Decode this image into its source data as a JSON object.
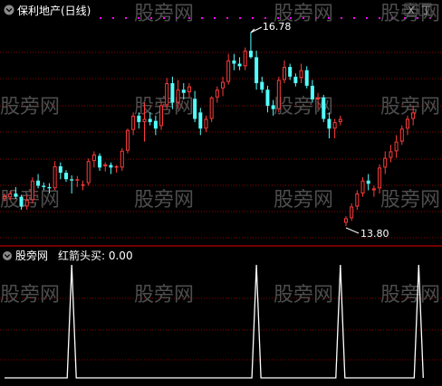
{
  "header": {
    "stock_title": "保利地产(日线)",
    "indicator_prefix": "股旁网",
    "indicator_label": "红箭头买: 0.00",
    "x_box": "X",
    "corner_box": "丁"
  },
  "watermark_text": "股旁网",
  "colors": {
    "background": "#000000",
    "up": "#ff3c3c",
    "down": "#54ffff",
    "grid": "#8b0000",
    "divider": "#9a0000",
    "line": "#ffffff",
    "dots": "#ff00ff",
    "text": "#ffffff",
    "watermark": "#555555"
  },
  "chart_data": [
    {
      "type": "candlestick",
      "title": "保利地产(日线)",
      "annotations": [
        {
          "label": "16.78",
          "value": 16.78,
          "kind": "max"
        },
        {
          "label": "13.80",
          "value": 13.8,
          "kind": "min"
        }
      ],
      "candles": [
        [
          14.22,
          14.3,
          14.18,
          14.26
        ],
        [
          14.24,
          14.34,
          14.2,
          14.3
        ],
        [
          14.3,
          14.4,
          14.22,
          14.25
        ],
        [
          14.25,
          14.28,
          14.05,
          14.1
        ],
        [
          14.1,
          14.28,
          14.05,
          14.2
        ],
        [
          14.2,
          14.55,
          14.15,
          14.5
        ],
        [
          14.5,
          14.6,
          14.38,
          14.42
        ],
        [
          14.42,
          14.47,
          14.35,
          14.4
        ],
        [
          14.4,
          14.46,
          14.3,
          14.38
        ],
        [
          14.38,
          14.8,
          14.35,
          14.72
        ],
        [
          14.72,
          14.78,
          14.52,
          14.62
        ],
        [
          14.62,
          14.66,
          14.48,
          14.52
        ],
        [
          14.52,
          14.58,
          14.3,
          14.5
        ],
        [
          14.5,
          14.57,
          14.4,
          14.52
        ],
        [
          14.42,
          14.5,
          14.35,
          14.44
        ],
        [
          14.46,
          14.84,
          14.42,
          14.8
        ],
        [
          14.8,
          14.95,
          14.7,
          14.9
        ],
        [
          14.88,
          14.92,
          14.65,
          14.7
        ],
        [
          14.72,
          14.78,
          14.64,
          14.75
        ],
        [
          14.74,
          14.78,
          14.6,
          14.7
        ],
        [
          14.7,
          14.74,
          14.62,
          14.72
        ],
        [
          14.7,
          15.0,
          14.65,
          14.96
        ],
        [
          14.96,
          15.3,
          14.92,
          15.28
        ],
        [
          15.28,
          15.55,
          15.2,
          15.5
        ],
        [
          15.5,
          15.55,
          15.3,
          15.4
        ],
        [
          15.4,
          15.7,
          15.1,
          15.45
        ],
        [
          15.45,
          15.55,
          15.35,
          15.4
        ],
        [
          15.42,
          15.5,
          15.2,
          15.3
        ],
        [
          15.34,
          15.7,
          15.28,
          15.66
        ],
        [
          15.66,
          16.08,
          15.6,
          16.0
        ],
        [
          16.0,
          16.1,
          15.6,
          15.7
        ],
        [
          15.7,
          16.05,
          15.6,
          15.9
        ],
        [
          15.9,
          16.0,
          15.75,
          15.85
        ],
        [
          15.86,
          16.0,
          15.78,
          15.95
        ],
        [
          15.76,
          15.88,
          15.4,
          15.45
        ],
        [
          15.55,
          15.62,
          15.2,
          15.3
        ],
        [
          15.3,
          15.5,
          15.25,
          15.45
        ],
        [
          15.45,
          15.8,
          15.4,
          15.78
        ],
        [
          15.78,
          15.95,
          15.7,
          15.9
        ],
        [
          15.92,
          16.1,
          15.8,
          16.02
        ],
        [
          16.02,
          16.45,
          15.98,
          16.35
        ],
        [
          16.35,
          16.45,
          16.2,
          16.3
        ],
        [
          16.3,
          16.4,
          16.2,
          16.26
        ],
        [
          16.26,
          16.55,
          16.2,
          16.5
        ],
        [
          16.5,
          16.78,
          16.38,
          16.4
        ],
        [
          16.4,
          16.5,
          15.9,
          16.0
        ],
        [
          16.02,
          16.1,
          15.85,
          15.9
        ],
        [
          15.9,
          15.96,
          15.55,
          15.65
        ],
        [
          15.66,
          15.74,
          15.5,
          15.6
        ],
        [
          15.6,
          16.1,
          15.55,
          16.05
        ],
        [
          16.05,
          16.35,
          16.0,
          16.25
        ],
        [
          16.25,
          16.3,
          16.05,
          16.1
        ],
        [
          16.1,
          16.15,
          15.95,
          16.0
        ],
        [
          16.08,
          16.3,
          16.0,
          16.2
        ],
        [
          16.2,
          16.26,
          15.92,
          15.96
        ],
        [
          15.96,
          16.05,
          15.7,
          15.75
        ],
        [
          15.75,
          15.85,
          15.6,
          15.78
        ],
        [
          15.78,
          15.82,
          15.4,
          15.45
        ],
        [
          15.45,
          15.55,
          15.15,
          15.3
        ],
        [
          15.3,
          15.45,
          15.15,
          15.4
        ],
        [
          15.4,
          15.5,
          15.35,
          15.45
        ],
        [
          13.85,
          13.95,
          13.8,
          13.92
        ],
        [
          13.92,
          14.15,
          13.88,
          14.1
        ],
        [
          14.1,
          14.35,
          14.05,
          14.3
        ],
        [
          14.3,
          14.55,
          14.25,
          14.5
        ],
        [
          14.5,
          14.6,
          14.35,
          14.45
        ],
        [
          14.35,
          14.42,
          14.25,
          14.38
        ],
        [
          14.38,
          14.75,
          14.3,
          14.7
        ],
        [
          14.7,
          14.95,
          14.6,
          14.85
        ],
        [
          14.85,
          15.05,
          14.78,
          14.95
        ],
        [
          14.95,
          15.2,
          14.85,
          15.1
        ],
        [
          15.1,
          15.35,
          15.05,
          15.3
        ],
        [
          15.3,
          15.5,
          15.2,
          15.45
        ],
        [
          15.45,
          15.65,
          15.35,
          15.55
        ]
      ]
    },
    {
      "type": "line",
      "title": "红箭头买",
      "current_value": 0.0,
      "x": [
        0,
        12,
        22,
        30,
        45,
        55,
        60,
        63,
        74
      ],
      "y": [
        0,
        1,
        0,
        0,
        1,
        0,
        1,
        0,
        1
      ]
    }
  ]
}
